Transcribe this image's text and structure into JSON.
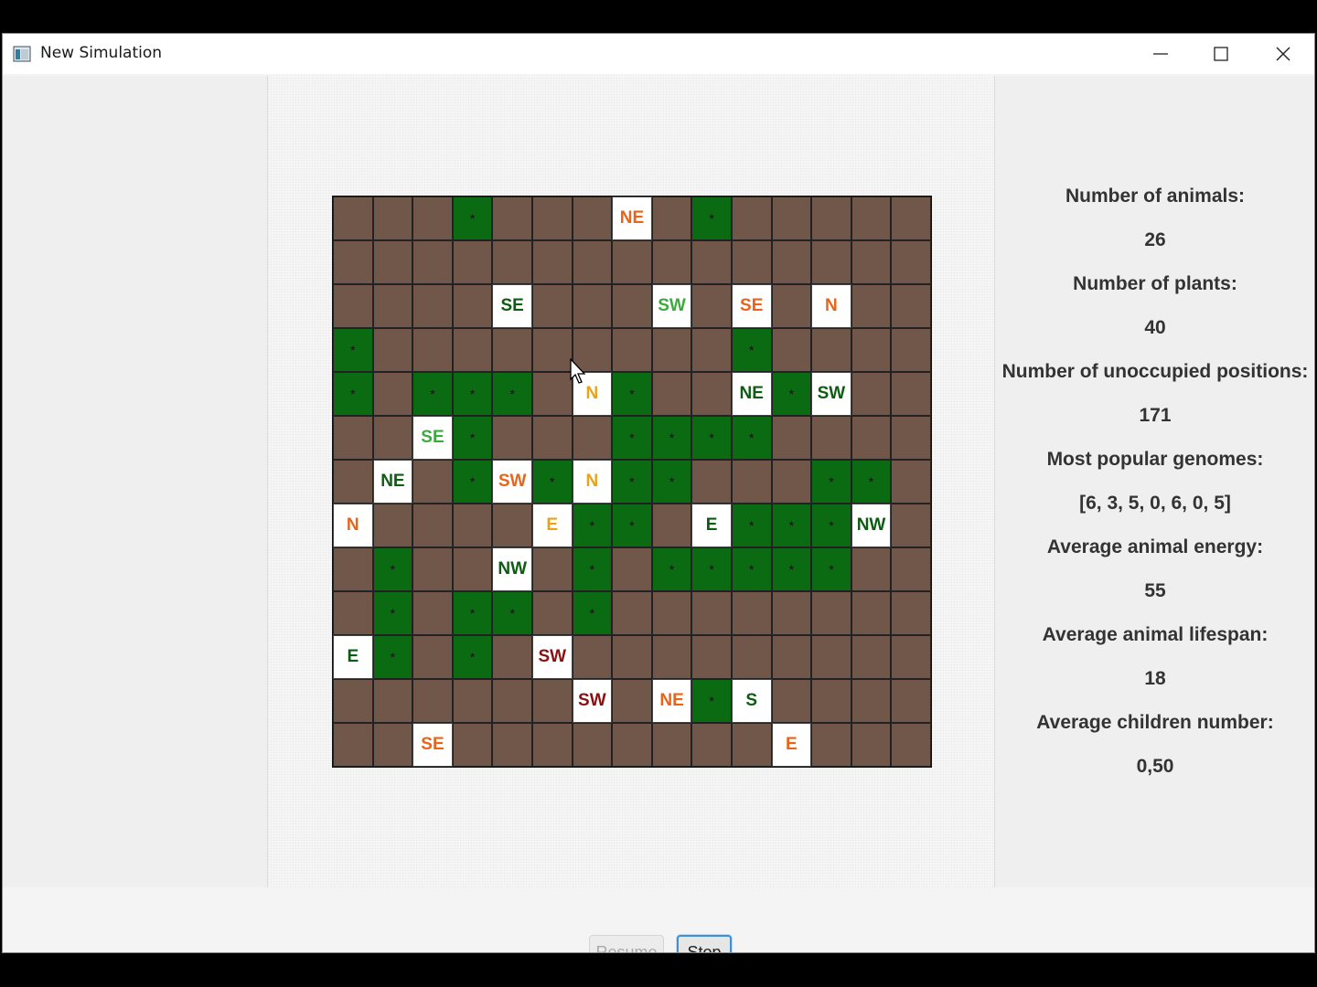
{
  "window": {
    "title": "New Simulation"
  },
  "colors": {
    "soil": "#70574a",
    "plant": "#0a6b13",
    "animal_bg": "#ffffff",
    "energy_high": "#0d5c12",
    "energy_good": "#3cab3e",
    "energy_mid": "#e8a317",
    "energy_low": "#e8641a",
    "energy_critical": "#8b1010"
  },
  "map": {
    "columns": 15,
    "rows": 13,
    "plant_symbol": "*",
    "cells": [
      [
        "",
        "",
        "",
        "*",
        "",
        "",
        "",
        "NE|low",
        "",
        "*",
        "",
        "",
        "",
        "",
        ""
      ],
      [
        "",
        "",
        "",
        "",
        "",
        "",
        "",
        "",
        "",
        "",
        "",
        "",
        "",
        "",
        ""
      ],
      [
        "",
        "",
        "",
        "",
        "SE|high",
        "",
        "",
        "",
        "SW|good",
        "",
        "SE|low",
        "",
        "N|low",
        "",
        ""
      ],
      [
        "*",
        "",
        "",
        "",
        "",
        "",
        "",
        "",
        "",
        "",
        "*",
        "",
        "",
        "",
        ""
      ],
      [
        "*",
        "",
        "*",
        "*",
        "*",
        "",
        "N|mid",
        "*",
        "",
        "",
        "NE|high",
        "*",
        "SW|high",
        "",
        ""
      ],
      [
        "",
        "",
        "SE|good",
        "*",
        "",
        "",
        "",
        "*",
        "*",
        "*",
        "*",
        "",
        "",
        "",
        ""
      ],
      [
        "",
        "NE|high",
        "",
        "*",
        "SW|low",
        "*",
        "N|mid",
        "*",
        "*",
        "",
        "",
        "",
        "*",
        "*",
        ""
      ],
      [
        "N|low",
        "",
        "",
        "",
        "",
        "E|mid",
        "*",
        "*",
        "",
        "E|high",
        "*",
        "*",
        "*",
        "NW|high",
        ""
      ],
      [
        "",
        "*",
        "",
        "",
        "NW|high",
        "",
        "*",
        "",
        "*",
        "*",
        "*",
        "*",
        "*",
        "",
        ""
      ],
      [
        "",
        "*",
        "",
        "*",
        "*",
        "",
        "*",
        "",
        "",
        "",
        "",
        "",
        "",
        "",
        ""
      ],
      [
        "E|high",
        "*",
        "",
        "*",
        "",
        "SW|critical",
        "",
        "",
        "",
        "",
        "",
        "",
        "",
        "",
        ""
      ],
      [
        "",
        "",
        "",
        "",
        "",
        "",
        "SW|critical",
        "",
        "NE|low",
        "*",
        "S|high",
        "",
        "",
        "",
        ""
      ],
      [
        "",
        "",
        "SE|low",
        "",
        "",
        "",
        "",
        "",
        "",
        "",
        "",
        "E|low",
        "",
        "",
        ""
      ]
    ]
  },
  "stats": [
    {
      "label": "Number of animals:",
      "value": "26"
    },
    {
      "label": "Number of plants:",
      "value": "40"
    },
    {
      "label": "Number of unoccupied positions:",
      "value": "171"
    },
    {
      "label": "Most popular genomes:",
      "value": "[6, 3, 5, 0, 6, 0, 5]"
    },
    {
      "label": "Average animal energy:",
      "value": "55"
    },
    {
      "label": "Average animal lifespan:",
      "value": "18"
    },
    {
      "label": "Average children number:",
      "value": "0,50"
    }
  ],
  "controls": {
    "resume_label": "Resume",
    "stop_label": "Stop"
  }
}
